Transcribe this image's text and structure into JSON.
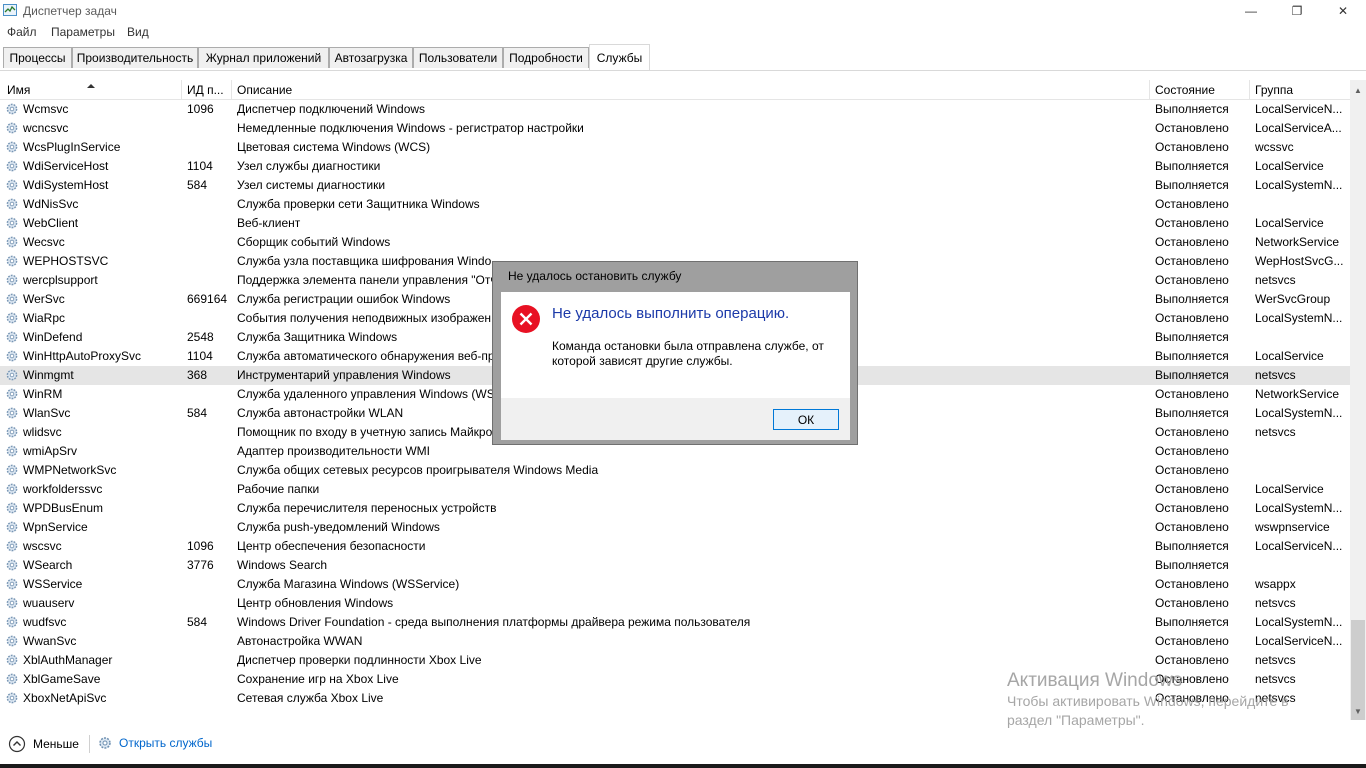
{
  "window": {
    "title": "Диспетчер задач",
    "minimize": "—",
    "maximize": "❐",
    "close": "✕"
  },
  "menu": [
    "Файл",
    "Параметры",
    "Вид"
  ],
  "tabs": [
    "Процессы",
    "Производительность",
    "Журнал приложений",
    "Автозагрузка",
    "Пользователи",
    "Подробности",
    "Службы"
  ],
  "active_tab": "Службы",
  "columns": {
    "name": "Имя",
    "pid": "ИД п...",
    "description": "Описание",
    "status": "Состояние",
    "group": "Группа"
  },
  "services": [
    {
      "name": "Wcmsvc",
      "pid": "1096",
      "description": "Диспетчер подключений Windows",
      "status": "Выполняется",
      "group": "LocalServiceN..."
    },
    {
      "name": "wcncsvc",
      "pid": "",
      "description": "Немедленные подключения Windows - регистратор настройки",
      "status": "Остановлено",
      "group": "LocalServiceA..."
    },
    {
      "name": "WcsPlugInService",
      "pid": "",
      "description": "Цветовая система Windows (WCS)",
      "status": "Остановлено",
      "group": "wcssvc"
    },
    {
      "name": "WdiServiceHost",
      "pid": "1104",
      "description": "Узел службы диагностики",
      "status": "Выполняется",
      "group": "LocalService"
    },
    {
      "name": "WdiSystemHost",
      "pid": "584",
      "description": "Узел системы диагностики",
      "status": "Выполняется",
      "group": "LocalSystemN..."
    },
    {
      "name": "WdNisSvc",
      "pid": "",
      "description": "Служба проверки сети Защитника Windows",
      "status": "Остановлено",
      "group": ""
    },
    {
      "name": "WebClient",
      "pid": "",
      "description": "Веб-клиент",
      "status": "Остановлено",
      "group": "LocalService"
    },
    {
      "name": "Wecsvc",
      "pid": "",
      "description": "Сборщик событий Windows",
      "status": "Остановлено",
      "group": "NetworkService"
    },
    {
      "name": "WEPHOSTSVC",
      "pid": "",
      "description": "Служба узла поставщика шифрования Windo",
      "status": "Остановлено",
      "group": "WepHostSvcG..."
    },
    {
      "name": "wercplsupport",
      "pid": "",
      "description": "Поддержка элемента панели управления \"Отч",
      "status": "Остановлено",
      "group": "netsvcs"
    },
    {
      "name": "WerSvc",
      "pid": "669164",
      "description": "Служба регистрации ошибок Windows",
      "status": "Выполняется",
      "group": "WerSvcGroup"
    },
    {
      "name": "WiaRpc",
      "pid": "",
      "description": "События получения неподвижных изображен",
      "status": "Остановлено",
      "group": "LocalSystemN..."
    },
    {
      "name": "WinDefend",
      "pid": "2548",
      "description": "Служба Защитника Windows",
      "status": "Выполняется",
      "group": ""
    },
    {
      "name": "WinHttpAutoProxySvc",
      "pid": "1104",
      "description": "Служба автоматического обнаружения веб-пр",
      "status": "Выполняется",
      "group": "LocalService"
    },
    {
      "name": "Winmgmt",
      "pid": "368",
      "description": "Инструментарий управления Windows",
      "status": "Выполняется",
      "group": "netsvcs"
    },
    {
      "name": "WinRM",
      "pid": "",
      "description": "Служба удаленного управления Windows (WS",
      "status": "Остановлено",
      "group": "NetworkService"
    },
    {
      "name": "WlanSvc",
      "pid": "584",
      "description": "Служба автонастройки WLAN",
      "status": "Выполняется",
      "group": "LocalSystemN..."
    },
    {
      "name": "wlidsvc",
      "pid": "",
      "description": "Помощник по входу в учетную запись Майкро",
      "status": "Остановлено",
      "group": "netsvcs"
    },
    {
      "name": "wmiApSrv",
      "pid": "",
      "description": "Адаптер производительности WMI",
      "status": "Остановлено",
      "group": ""
    },
    {
      "name": "WMPNetworkSvc",
      "pid": "",
      "description": "Служба общих сетевых ресурсов проигрывателя Windows Media",
      "status": "Остановлено",
      "group": ""
    },
    {
      "name": "workfolderssvc",
      "pid": "",
      "description": "Рабочие папки",
      "status": "Остановлено",
      "group": "LocalService"
    },
    {
      "name": "WPDBusEnum",
      "pid": "",
      "description": "Служба перечислителя переносных устройств",
      "status": "Остановлено",
      "group": "LocalSystemN..."
    },
    {
      "name": "WpnService",
      "pid": "",
      "description": "Служба push-уведомлений Windows",
      "status": "Остановлено",
      "group": "wswpnservice"
    },
    {
      "name": "wscsvc",
      "pid": "1096",
      "description": "Центр обеспечения безопасности",
      "status": "Выполняется",
      "group": "LocalServiceN..."
    },
    {
      "name": "WSearch",
      "pid": "3776",
      "description": "Windows Search",
      "status": "Выполняется",
      "group": ""
    },
    {
      "name": "WSService",
      "pid": "",
      "description": "Служба Магазина Windows (WSService)",
      "status": "Остановлено",
      "group": "wsappx"
    },
    {
      "name": "wuauserv",
      "pid": "",
      "description": "Центр обновления Windows",
      "status": "Остановлено",
      "group": "netsvcs"
    },
    {
      "name": "wudfsvc",
      "pid": "584",
      "description": "Windows Driver Foundation - среда выполнения платформы драйвера режима пользователя",
      "status": "Выполняется",
      "group": "LocalSystemN..."
    },
    {
      "name": "WwanSvc",
      "pid": "",
      "description": "Автонастройка WWAN",
      "status": "Остановлено",
      "group": "LocalServiceN..."
    },
    {
      "name": "XblAuthManager",
      "pid": "",
      "description": "Диспетчер проверки подлинности Xbox Live",
      "status": "Остановлено",
      "group": "netsvcs"
    },
    {
      "name": "XblGameSave",
      "pid": "",
      "description": "Сохранение игр на Xbox Live",
      "status": "Остановлено",
      "group": "netsvcs"
    },
    {
      "name": "XboxNetApiSvc",
      "pid": "",
      "description": "Сетевая служба Xbox Live",
      "status": "Остановлено",
      "group": "netsvcs"
    }
  ],
  "selected_service": "Winmgmt",
  "footer": {
    "fewer": "Меньше",
    "open_services": "Открыть службы"
  },
  "watermark": {
    "title": "Активация Windows",
    "line1": "Чтобы активировать Windows, перейдите в",
    "line2": "раздел \"Параметры\"."
  },
  "dialog": {
    "title": "Не удалось остановить службу",
    "heading": "Не удалось выполнить операцию.",
    "message": "Команда остановки была отправлена службе, от которой зависят другие службы.",
    "ok": "ОК"
  },
  "colors": {
    "accent": "#0078d7",
    "dialog_heading": "#1c3aa9",
    "error": "#e81123",
    "link": "#0066cc"
  }
}
